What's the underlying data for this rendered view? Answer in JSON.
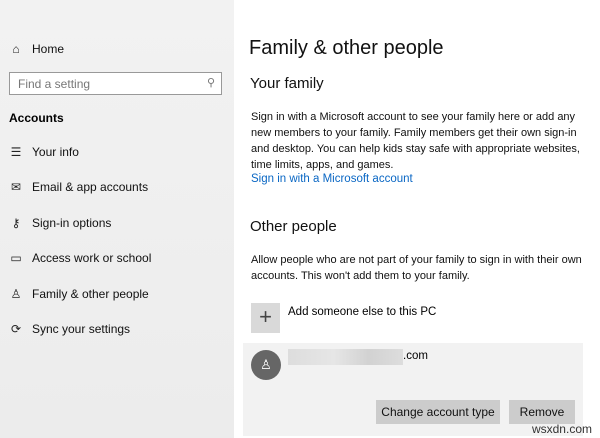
{
  "sidebar": {
    "home": "Home",
    "search_placeholder": "Find a setting",
    "section": "Accounts",
    "items": [
      {
        "label": "Your info",
        "icon": "contact-info-icon"
      },
      {
        "label": "Email & app accounts",
        "icon": "mail-icon"
      },
      {
        "label": "Sign-in options",
        "icon": "key-icon"
      },
      {
        "label": "Access work or school",
        "icon": "briefcase-icon"
      },
      {
        "label": "Family & other people",
        "icon": "person-add-icon"
      },
      {
        "label": "Sync your settings",
        "icon": "sync-icon"
      }
    ]
  },
  "main": {
    "title": "Family & other people",
    "your_family": {
      "heading": "Your family",
      "text": "Sign in with a Microsoft account to see your family here or add any new members to your family. Family members get their own sign-in and desktop. You can help kids stay safe with appropriate websites, time limits, apps, and games.",
      "link": "Sign in with a Microsoft account"
    },
    "other_people": {
      "heading": "Other people",
      "text": "Allow people who are not part of your family to sign in with their own accounts. This won't add them to your family.",
      "add_label": "Add someone else to this PC",
      "account_email_suffix": ".com",
      "change_button": "Change account type",
      "remove_button": "Remove"
    }
  },
  "watermark": "wsxdn.com"
}
